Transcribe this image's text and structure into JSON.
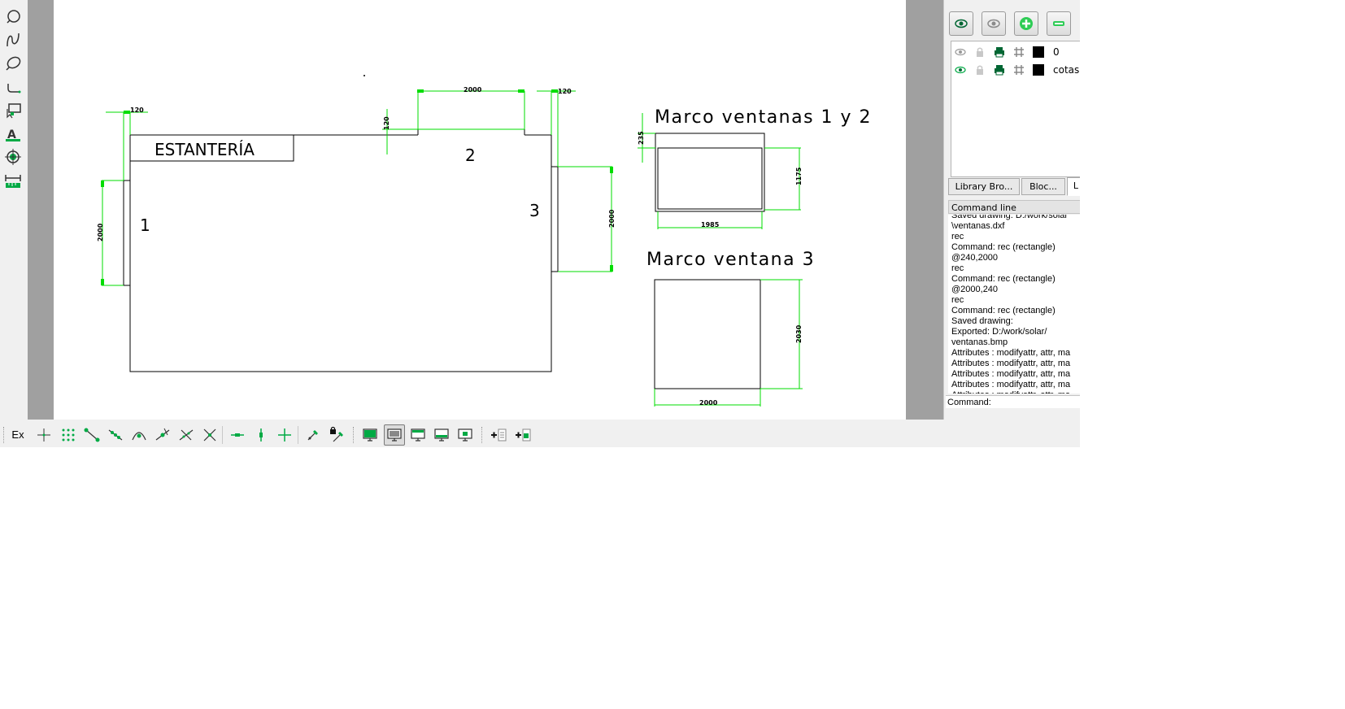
{
  "colors": {
    "accent": "#00aa44",
    "dimension": "#00dd00",
    "canvas_bg": "#ffffff",
    "ui_bg": "#f0f0f0"
  },
  "left_toolbar": {
    "tools": [
      {
        "name": "circle-tool-icon"
      },
      {
        "name": "freehand-tool-icon"
      },
      {
        "name": "ellipse-tool-icon"
      },
      {
        "name": "polyline-tool-icon"
      },
      {
        "name": "select-tool-icon"
      },
      {
        "name": "text-tool-icon"
      },
      {
        "name": "modify-tool-icon"
      },
      {
        "name": "dimension-tool-icon"
      }
    ]
  },
  "drawing": {
    "room_label": "ESTANTERÍA",
    "window_1": "1",
    "window_2": "2",
    "window_3": "3",
    "dim_120_a": "120",
    "dim_120_b": "120",
    "dim_120_c": "120",
    "dim_2000_top": "2000",
    "dim_2000_left": "2000",
    "dim_2000_right": "2000",
    "frame12_title": "Marco ventanas 1 y 2",
    "frame12_dim_235": "235",
    "frame12_dim_1175": "1175",
    "frame12_dim_1985": "1985",
    "frame3_title": "Marco ventana 3",
    "frame3_dim_2030": "2030",
    "frame3_dim_2000": "2000"
  },
  "layers": {
    "toolbar": [
      {
        "name": "show-all-layers-icon"
      },
      {
        "name": "hide-all-layers-icon"
      },
      {
        "name": "add-layer-icon"
      },
      {
        "name": "remove-layer-icon"
      }
    ],
    "rows": [
      {
        "name": "0",
        "visible": false,
        "color": "#000000"
      },
      {
        "name": "cotas",
        "visible": true,
        "color": "#000000"
      }
    ]
  },
  "tabs": [
    {
      "label": "Library Bro..."
    },
    {
      "label": "Bloc..."
    },
    {
      "label": "L"
    }
  ],
  "command_line": {
    "title": "Command line",
    "history": [
      "Saved drawing: D:/work/solar",
      "\\ventanas.dxf",
      "rec",
      "Command: rec (rectangle)",
      "@240,2000",
      "rec",
      "Command: rec (rectangle)",
      "@2000,240",
      "rec",
      "Command: rec (rectangle)",
      "Saved drawing:",
      "Exported: D:/work/solar/",
      "ventanas.bmp",
      "Attributes : modifyattr, attr, ma",
      "Attributes : modifyattr, attr, ma",
      "Attributes : modifyattr, attr, ma",
      "Attributes : modifyattr, attr, ma",
      "Attributes : modifyattr, attr, ma"
    ],
    "prompt": "Command:"
  },
  "bottom_toolbar": {
    "ex_label": "Ex"
  }
}
